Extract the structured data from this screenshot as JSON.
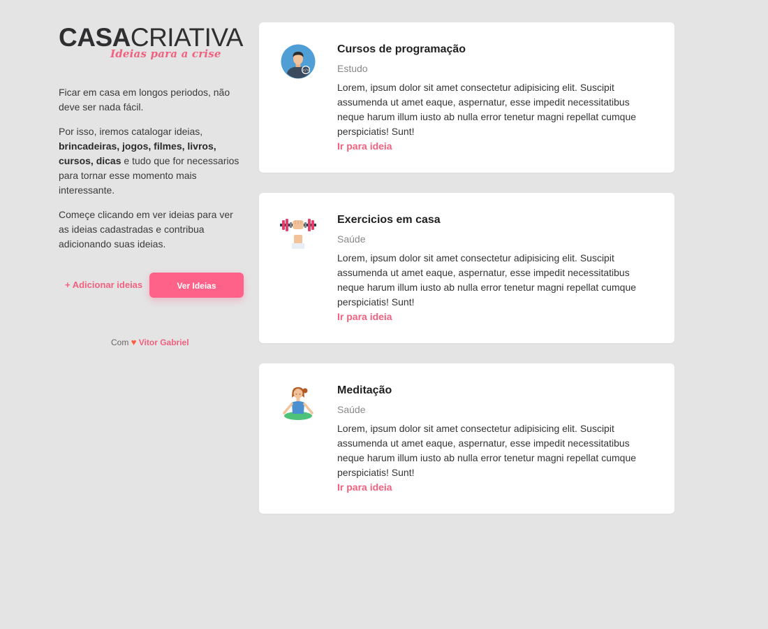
{
  "logo": {
    "main_bold": "CASA",
    "main_light": "CRIATIVA",
    "tagline": "Ideias para a crise"
  },
  "intro": {
    "p1": "Ficar em casa em longos periodos, não deve ser nada fácil.",
    "p2_start": "Por isso, iremos catalogar ideias, ",
    "p2_bold": "brincadeiras, jogos, filmes, livros, cursos, dicas",
    "p2_end": " e tudo que for necessarios para tornar esse momento mais interessante.",
    "p3": "Começe clicando em ver ideias para ver as ideias cadastradas e contribua adicionando suas ideias."
  },
  "actions": {
    "add_label": "+ Adicionar ideias",
    "view_label": "Ver Ideias"
  },
  "credit": {
    "prefix": "Com",
    "heart": "♥",
    "author": "Vitor Gabriel"
  },
  "cards": [
    {
      "icon": "programmer-icon",
      "title": "Cursos de programação",
      "category": "Estudo",
      "description": "Lorem, ipsum dolor sit amet consectetur adipisicing elit. Suscipit assumenda ut amet eaque, aspernatur, esse impedit necessitatibus neque harum illum iusto ab nulla error tenetur magni repellat cumque perspiciatis! Sunt!",
      "link": "Ir para ideia"
    },
    {
      "icon": "dumbbell-icon",
      "title": "Exercicios em casa",
      "category": "Saúde",
      "description": "Lorem, ipsum dolor sit amet consectetur adipisicing elit. Suscipit assumenda ut amet eaque, aspernatur, esse impedit necessitatibus neque harum illum iusto ab nulla error tenetur magni repellat cumque perspiciatis! Sunt!",
      "link": "Ir para ideia"
    },
    {
      "icon": "meditation-icon",
      "title": "Meditação",
      "category": "Saúde",
      "description": "Lorem, ipsum dolor sit amet consectetur adipisicing elit. Suscipit assumenda ut amet eaque, aspernatur, esse impedit necessitatibus neque harum illum iusto ab nulla error tenetur magni repellat cumque perspiciatis! Sunt!",
      "link": "Ir para ideia"
    }
  ],
  "colors": {
    "accent": "#f0617f",
    "button": "#ff6289",
    "background": "#e4e4e4",
    "card": "#ffffff"
  }
}
